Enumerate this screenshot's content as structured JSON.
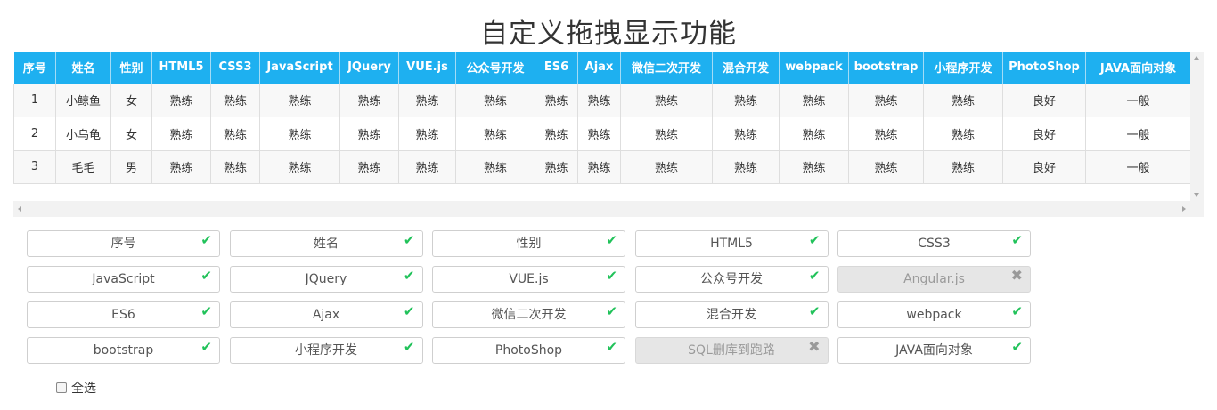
{
  "title": "自定义拖拽显示功能",
  "table": {
    "headers": [
      "序号",
      "姓名",
      "性别",
      "HTML5",
      "CSS3",
      "JavaScript",
      "JQuery",
      "VUE.js",
      "公众号开发",
      "ES6",
      "Ajax",
      "微信二次开发",
      "混合开发",
      "webpack",
      "bootstrap",
      "小程序开发",
      "PhotoShop",
      "JAVA面向对象"
    ],
    "rows": [
      [
        "1",
        "小鲸鱼",
        "女",
        "熟练",
        "熟练",
        "熟练",
        "熟练",
        "熟练",
        "熟练",
        "熟练",
        "熟练",
        "熟练",
        "熟练",
        "熟练",
        "熟练",
        "熟练",
        "良好",
        "一般"
      ],
      [
        "2",
        "小乌龟",
        "女",
        "熟练",
        "熟练",
        "熟练",
        "熟练",
        "熟练",
        "熟练",
        "熟练",
        "熟练",
        "熟练",
        "熟练",
        "熟练",
        "熟练",
        "熟练",
        "良好",
        "一般"
      ],
      [
        "3",
        "毛毛",
        "男",
        "熟练",
        "熟练",
        "熟练",
        "熟练",
        "熟练",
        "熟练",
        "熟练",
        "熟练",
        "熟练",
        "熟练",
        "熟练",
        "熟练",
        "熟练",
        "良好",
        "一般"
      ]
    ]
  },
  "options": [
    {
      "label": "序号",
      "checked": true
    },
    {
      "label": "姓名",
      "checked": true
    },
    {
      "label": "性别",
      "checked": true
    },
    {
      "label": "HTML5",
      "checked": true
    },
    {
      "label": "CSS3",
      "checked": true
    },
    {
      "label": "JavaScript",
      "checked": true
    },
    {
      "label": "JQuery",
      "checked": true
    },
    {
      "label": "VUE.js",
      "checked": true
    },
    {
      "label": "公众号开发",
      "checked": true
    },
    {
      "label": "Angular.js",
      "checked": false
    },
    {
      "label": "ES6",
      "checked": true
    },
    {
      "label": "Ajax",
      "checked": true
    },
    {
      "label": "微信二次开发",
      "checked": true
    },
    {
      "label": "混合开发",
      "checked": true
    },
    {
      "label": "webpack",
      "checked": true
    },
    {
      "label": "bootstrap",
      "checked": true
    },
    {
      "label": "小程序开发",
      "checked": true
    },
    {
      "label": "PhotoShop",
      "checked": true
    },
    {
      "label": "SQL删库到跑路",
      "checked": false
    },
    {
      "label": "JAVA面向对象",
      "checked": true
    }
  ],
  "select_all": {
    "label": "全选",
    "checked": false
  },
  "colors": {
    "header_bg": "#1eb0f0",
    "check": "#21c25a",
    "cross": "#9a9a9a",
    "disabled_bg": "#e6e6e6"
  },
  "icons": {
    "checked": "check-icon",
    "unchecked": "cross-icon"
  }
}
